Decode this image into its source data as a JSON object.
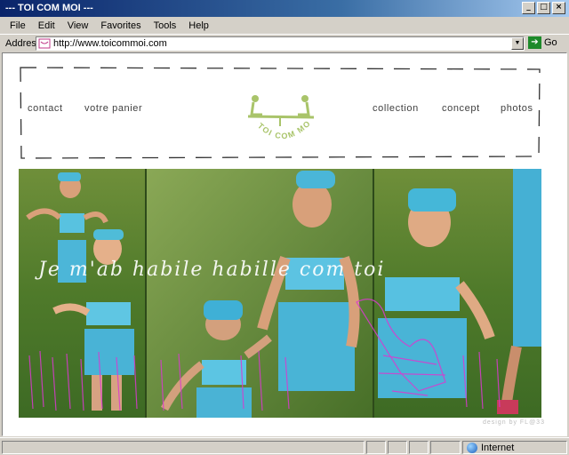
{
  "window": {
    "title": "--- TOI COM MOI ---",
    "buttons": [
      "minimize",
      "maximize",
      "close"
    ]
  },
  "menu": [
    "File",
    "Edit",
    "View",
    "Favorites",
    "Tools",
    "Help"
  ],
  "address": {
    "label": "Address",
    "url": "http://www.toicommoi.com",
    "go_label": "Go"
  },
  "site": {
    "nav_left": [
      "contact",
      "votre panier"
    ],
    "nav_right": [
      "collection",
      "concept",
      "photos"
    ],
    "logo_text": "TOI COM MOI",
    "logo_color": "#a9c46a",
    "scribble_text": "Je m'ab habile habille com toi",
    "credit": "design by FL@33"
  },
  "status": {
    "zone": "Internet"
  }
}
